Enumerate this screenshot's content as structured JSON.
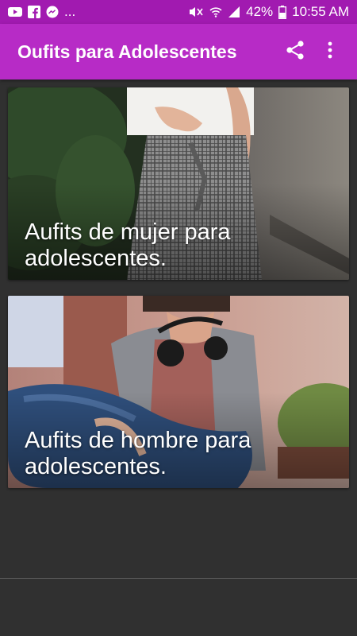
{
  "status_bar": {
    "notification_icons": [
      "youtube-icon",
      "facebook-icon",
      "messenger-icon"
    ],
    "overflow": "...",
    "battery": "42%",
    "time": "10:55 AM",
    "indicator_icons": [
      "mute-icon",
      "wifi-icon",
      "signal-icon",
      "battery-icon"
    ]
  },
  "app_bar": {
    "title": "Oufits para Adolescentes",
    "actions": [
      "share-icon",
      "more-vert-icon"
    ],
    "color": "#b72bc6"
  },
  "cards": [
    {
      "caption": "Aufits de mujer para adolescentes."
    },
    {
      "caption": "Aufits de hombre para adolescentes."
    }
  ],
  "colors": {
    "status_bar": "#a11ab0",
    "background": "#303030"
  }
}
